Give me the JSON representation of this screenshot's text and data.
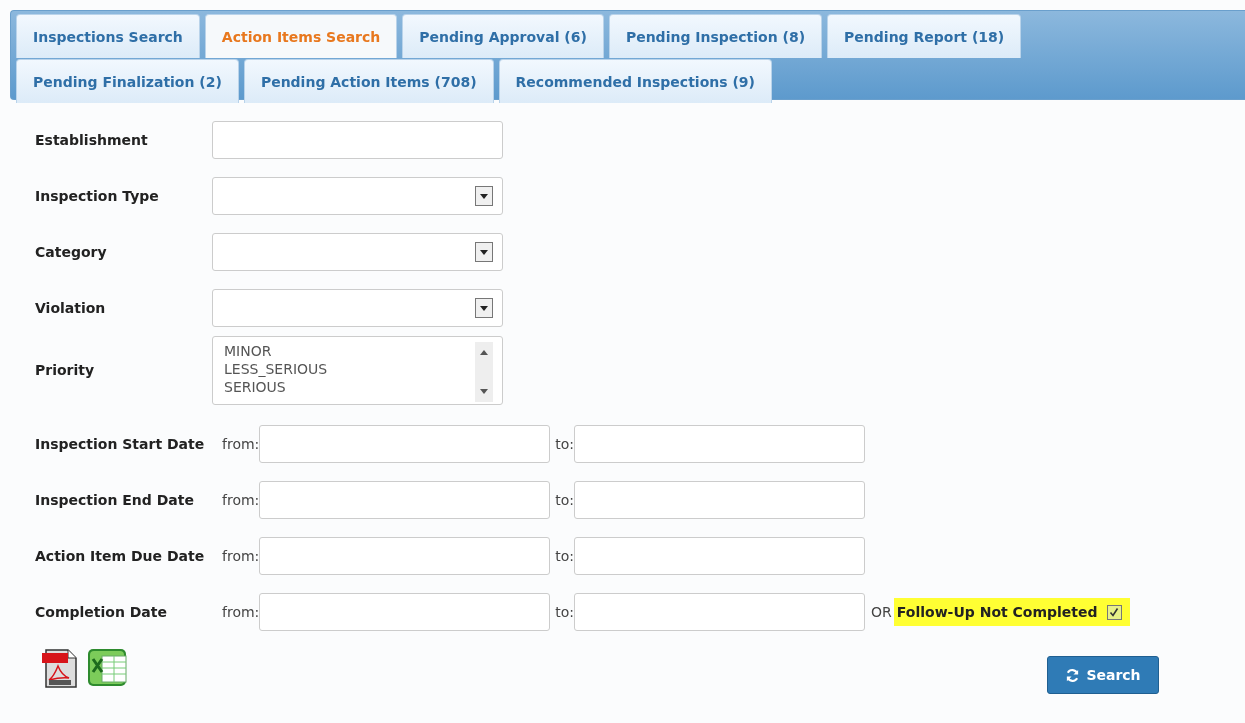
{
  "tab_rows": [
    [
      {
        "label": "Inspections Search",
        "selected": false
      },
      {
        "label": "Action Items Search",
        "selected": true
      },
      {
        "label": "Pending Approval (6)",
        "selected": false
      },
      {
        "label": "Pending Inspection (8)",
        "selected": false
      },
      {
        "label": "Pending Report (18)",
        "selected": false
      }
    ],
    [
      {
        "label": "Pending Finalization (2)",
        "selected": false
      },
      {
        "label": "Pending Action Items (708)",
        "selected": false
      },
      {
        "label": "Recommended Inspections (9)",
        "selected": false
      }
    ]
  ],
  "fields": [
    {
      "label": "Establishment",
      "kind": "text"
    },
    {
      "label": "Inspection Type",
      "kind": "select"
    },
    {
      "label": "Category",
      "kind": "select"
    },
    {
      "label": "Violation",
      "kind": "select"
    },
    {
      "label": "Priority",
      "kind": "listbox",
      "options": [
        "MINOR",
        "LESS_SERIOUS",
        "SERIOUS"
      ]
    }
  ],
  "date_fields": [
    {
      "label": "Inspection Start Date",
      "from_label": "from:",
      "to_label": "to:"
    },
    {
      "label": "Inspection End Date",
      "from_label": "from:",
      "to_label": "to:"
    },
    {
      "label": "Action Item Due Date",
      "from_label": "from:",
      "to_label": "to:"
    },
    {
      "label": "Completion Date",
      "from_label": "from:",
      "to_label": "to:"
    }
  ],
  "follow_up": {
    "prefix": "OR",
    "label": "Follow-Up Not Completed",
    "checked": true
  },
  "search_button": {
    "label": "Search"
  }
}
